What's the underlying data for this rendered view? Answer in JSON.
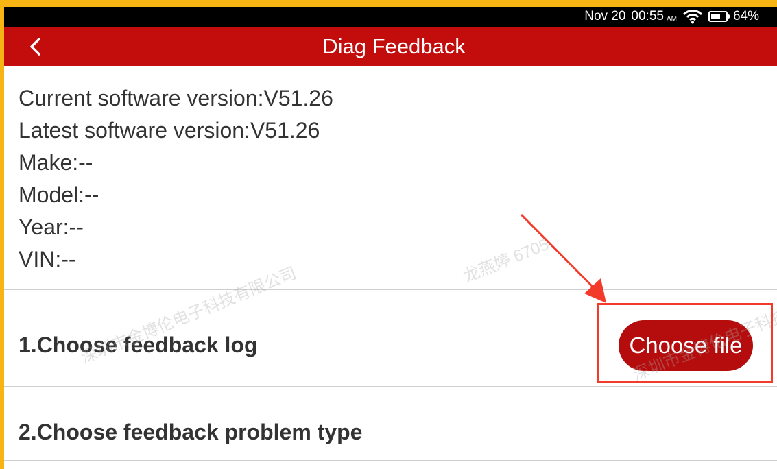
{
  "status_bar": {
    "date": "Nov 20",
    "time": "00:55",
    "ampm": "AM",
    "battery_percent": "64%",
    "battery_level": 0.64
  },
  "header": {
    "title": "Diag Feedback",
    "back_icon": "chevron-left-icon"
  },
  "info_lines": [
    "Current software version:V51.26",
    "Latest software version:V51.26",
    "Make:--",
    "Model:--",
    "Year:--",
    "VIN:--"
  ],
  "steps": {
    "choose_log_label": "1.Choose feedback log",
    "choose_file_button": "Choose file",
    "problem_type_label": "2.Choose feedback problem type"
  },
  "watermarks": [
    "深圳市金博伦电子科技有限公司",
    "龙燕婷 6705"
  ],
  "colors": {
    "header_red": "#c30d0d",
    "button_red": "#b50d0d",
    "annotation_red": "#f23b2b",
    "frame_yellow": "#f6b512"
  }
}
